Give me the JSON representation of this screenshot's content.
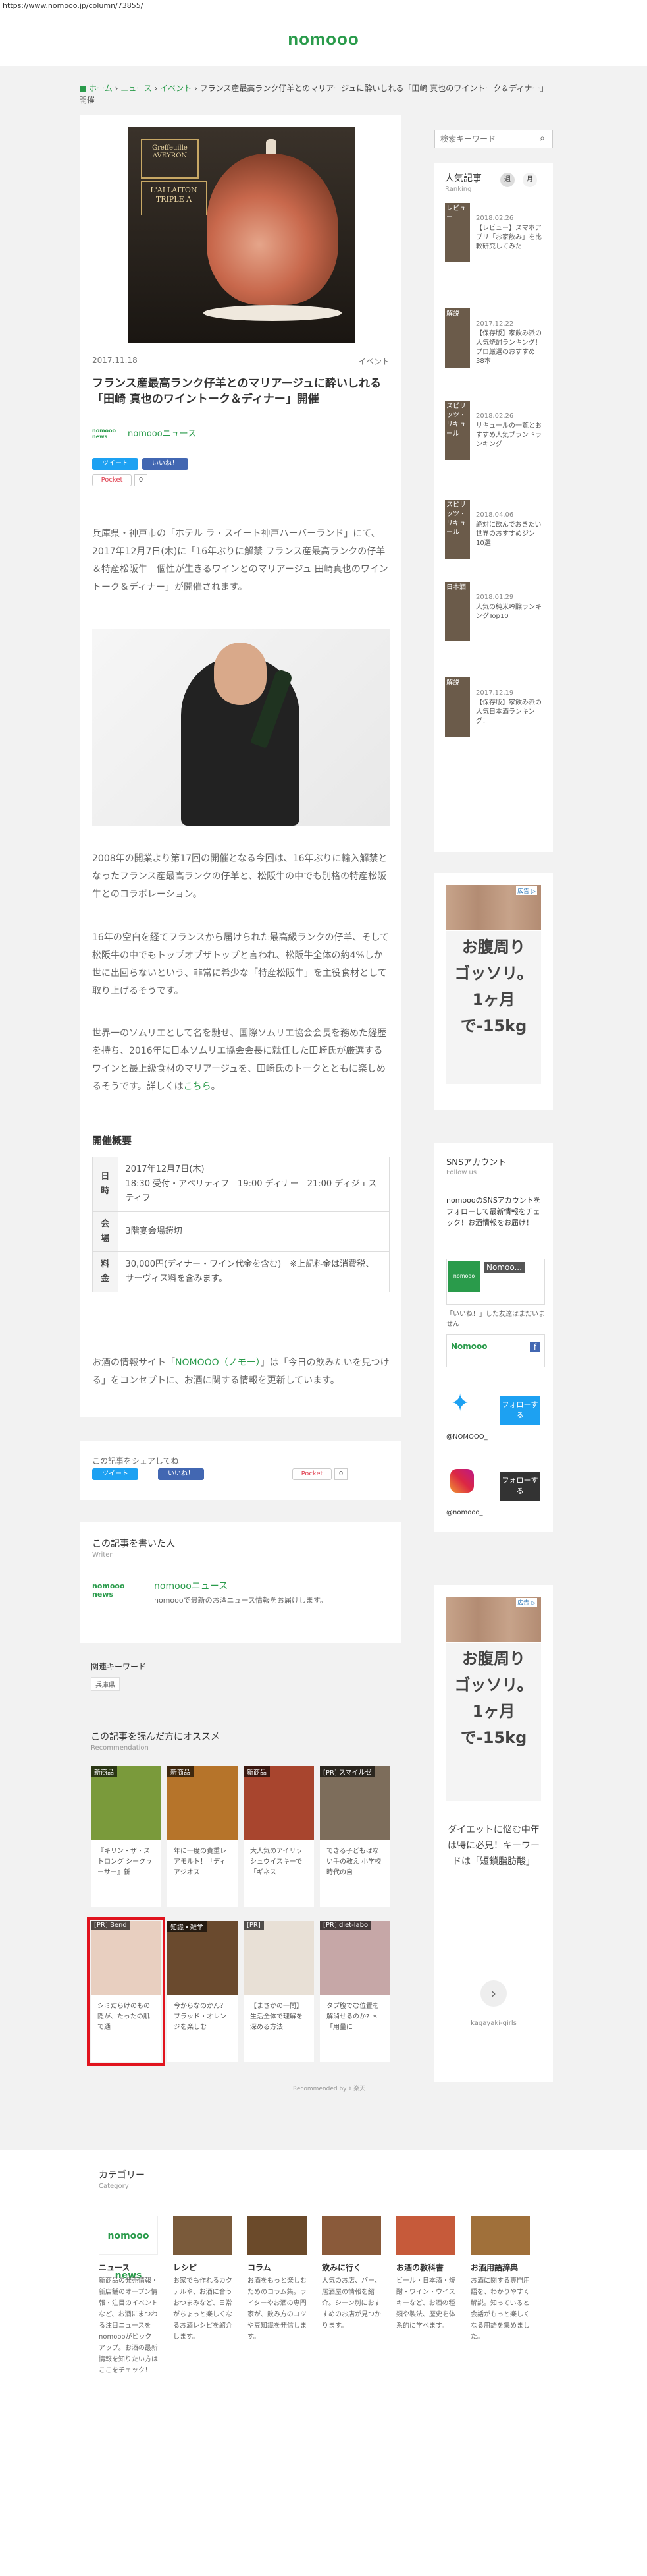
{
  "url": "https://www.nomooo.jp/column/73855/",
  "header": {
    "logo": "nomooo"
  },
  "breadcrumb": {
    "home": "ホーム",
    "news": "ニュース",
    "event": "イベント",
    "sep": "›",
    "current": "フランス産最高ランク仔羊とのマリアージュに酔いしれる「田崎 真也のワイントーク＆ディナー」開催"
  },
  "hero": {
    "badge1": "Greffeuille AVEYRON",
    "badge2": "L'ALLAITON TRIPLE A"
  },
  "article": {
    "date": "2017.11.18",
    "category": "イベント",
    "title": "フランス産最高ランク仔羊とのマリアージュに酔いしれる「田崎 真也のワイントーク＆ディナー」開催",
    "author": "nomoooニュース",
    "author_logo": "nomooo news",
    "tweet": "ツイート",
    "like": "いいね！",
    "pocket": "Pocket",
    "pocket_count": "0",
    "p1": "兵庫県・神戸市の「ホテル ラ・スイート神戸ハーバーランド」にて、2017年12月7日(木)に「16年ぶりに解禁 フランス産最高ランクの仔羊＆特産松阪牛　個性が生きるワインとのマリアージュ 田崎真也のワイントーク＆ディナー」が開催されます。",
    "p2": "2008年の開業より第17回の開催となる今回は、16年ぶりに輸入解禁となったフランス産最高ランクの仔羊と、松阪牛の中でも別格の特産松阪牛とのコラボレーション。",
    "p3": "16年の空白を経てフランスから届けられた最高級ランクの仔羊、そして松阪牛の中でもトップオブザトップと言われ、松阪牛全体の約4%しか世に出回らないという、非常に希少な「特産松阪牛」を主役食材として取り上げるそうです。",
    "p4_text": "世界一のソムリエとして名を馳せ、国際ソムリエ協会会長を務めた経歴を持ち、2016年に日本ソムリエ協会会長に就任した田崎氏が厳選するワインと最上級食材のマリアージュを、田崎氏のトークとともに楽しめるそうです。詳しくは",
    "p4_link": "こちら",
    "p4_end": "。",
    "section": "開催概要",
    "table": [
      {
        "th": "日時",
        "td": "2017年12月7日(木)\n18:30 受付・アペリティフ　19:00 ディナー　21:00 ディジェスティフ"
      },
      {
        "th": "会場",
        "td": "3階宴会場鎧切"
      },
      {
        "th": "料金",
        "td": "30,000円(ディナー・ワイン代金を含む)　※上記料金は消費税、サーヴィス料を含みます。"
      }
    ],
    "p5_pre": "お酒の情報サイト「",
    "p5_link": "NOMOOO（ノモー）",
    "p5_post": "」は「今日の飲みたいを見つける」をコンセプトに、お酒に関する情報を更新しています。"
  },
  "share_card": {
    "label": "この記事をシェアしてね",
    "tweet": "ツイート",
    "like": "いいね！",
    "pocket": "Pocket",
    "count": "0"
  },
  "writer": {
    "heading": "この記事を書いた人",
    "sub": "Writer",
    "name": "nomoooニュース",
    "desc": "nomoooで最新のお酒ニュース情報をお届けします。",
    "logo": "nomooo news"
  },
  "keywords": {
    "heading": "関連キーワード",
    "tags": [
      "兵庫県"
    ]
  },
  "recommendation": {
    "heading": "この記事を読んだ方にオススメ",
    "sub": "Recommendation",
    "items": [
      {
        "tag": "新商品",
        "text": "『キリン・ザ・ストロング シークヮーサー』新",
        "color": "#7a9a3b"
      },
      {
        "tag": "新商品",
        "text": "年に一度の貴重レアモルト！「ディアジオス",
        "color": "#b6742a"
      },
      {
        "tag": "新商品",
        "text": "大人気のアイリッシュウイスキーで「ギネス",
        "color": "#a8452e"
      },
      {
        "tag": "[PR] スマイルゼ",
        "text": "できる子どもはない手の教え 小学校時代の自",
        "color": "#7d6d5b"
      },
      {
        "tag": "[PR] Bend",
        "text": "シミだらけのもの隠が、たったの肌で通",
        "color": "#e8cfc0"
      },
      {
        "tag": "知識・雑学",
        "text": "今からなのかん？ブラッド・オレンジを楽しむ",
        "color": "#6a4a2e"
      },
      {
        "tag": "[PR]",
        "text": "【まさかの一問】生活全体で理解を深める方法",
        "color": "#e8e0d6"
      },
      {
        "tag": "[PR] diet-labo",
        "text": "タプ腹でむ位置を解消せるのか? ＊「用量に",
        "color": "#c6a7a7"
      }
    ],
    "recommended_by": "Recommended by ⌖ 楽天"
  },
  "sidebar": {
    "search_placeholder": "検索キーワード",
    "ranking": {
      "heading": "人気記事",
      "sub": "Ranking",
      "tab1": "週",
      "tab2": "月",
      "items": [
        {
          "thumb": "レビュー",
          "date": "2018.02.26",
          "title": "【レビュー】スマホアプリ「お家飲み」を比較研究してみた"
        },
        {
          "thumb": "解説",
          "date": "2017.12.22",
          "title": "【保存版】家飲み派の人気焼酎ランキング！プロ厳選のおすすめ38本"
        },
        {
          "thumb": "スピリッツ・リキュール",
          "date": "2018.02.26",
          "title": "リキュールの一覧とおすすめ人気ブランドランキング"
        },
        {
          "thumb": "スピリッツ・リキュール",
          "date": "2018.04.06",
          "title": "絶対に飲んでおきたい世界のおすすめジン10選"
        },
        {
          "thumb": "日本酒",
          "date": "2018.01.29",
          "title": "人気の純米吟醸ランキングTop10"
        },
        {
          "thumb": "解説",
          "date": "2017.12.19",
          "title": "【保存版】家飲み派の人気日本酒ランキング！"
        }
      ]
    },
    "ads": [
      {
        "label": "広告 ▷",
        "line1": "お腹周り",
        "line2": "ゴッソリ。",
        "line3": "1ヶ月",
        "line4": "で-15kg"
      },
      {
        "label": "広告 ▷",
        "line1": "お腹周り",
        "line2": "ゴッソリ。",
        "line3": "1ヶ月",
        "line4": "で-15kg",
        "sub": "ダイエットに悩む中年は特に必見！キーワードは「短鎖脂肪酸」",
        "arrow": "›",
        "source": "kagayaki-girls"
      }
    ],
    "sns": {
      "heading": "SNSアカウント",
      "sub": "Follow us",
      "desc": "nomoooのSNSアカウントをフォローして最新情報をチェック！お酒情報をお届け！",
      "fb_page": "Nomoo...",
      "fb_like_text": "「いいね！」した友達はまだいません",
      "fb_page2": "Nomooo",
      "twitter_handle": "@NOMOOO_",
      "twitter_follow": "フォローする",
      "insta_handle": "@nomooo_",
      "insta_follow": "フォローする"
    }
  },
  "footer": {
    "heading": "カテゴリー",
    "sub": "Category",
    "categories": [
      {
        "name": "ニュース",
        "desc": "新商品の発売情報・新店舗のオープン情報・注目のイベントなど、お酒にまつわる注目ニュースをnomoooがピックアップ。お酒の最新情報を知りたい方はここをチェック！"
      },
      {
        "name": "レシピ",
        "desc": "お家でも作れるカクテルや、お酒に合うおつまみなど、日常がちょっと楽しくなるお酒レシピを紹介します。"
      },
      {
        "name": "コラム",
        "desc": "お酒をもっと楽しむためのコラム集。ライターやお酒の専門家が、飲み方のコツや豆知識を発信します。"
      },
      {
        "name": "飲みに行く",
        "desc": "人気のお店、バー、居酒屋の情報を紹介。シーン別におすすめのお店が見つかります。"
      },
      {
        "name": "お酒の教科書",
        "desc": "ビール・日本酒・焼酎・ワイン・ウイスキーなど、お酒の種類や製法、歴史を体系的に学べます。"
      },
      {
        "name": "お酒用語辞典",
        "desc": "お酒に関する専門用語を、わかりやすく解説。知っていると会話がもっと楽しくなる用語を集めました。"
      }
    ],
    "cat_colors": [
      "#ffffff",
      "#7a5a3a",
      "#6b4a2a",
      "#8a5a3a",
      "#c65a3a",
      "#a0703a"
    ]
  },
  "colors": {
    "brand_green": "#2a9b4b",
    "highlight_red": "#e1141e",
    "twitter": "#1da1f2",
    "facebook": "#4267b2"
  }
}
